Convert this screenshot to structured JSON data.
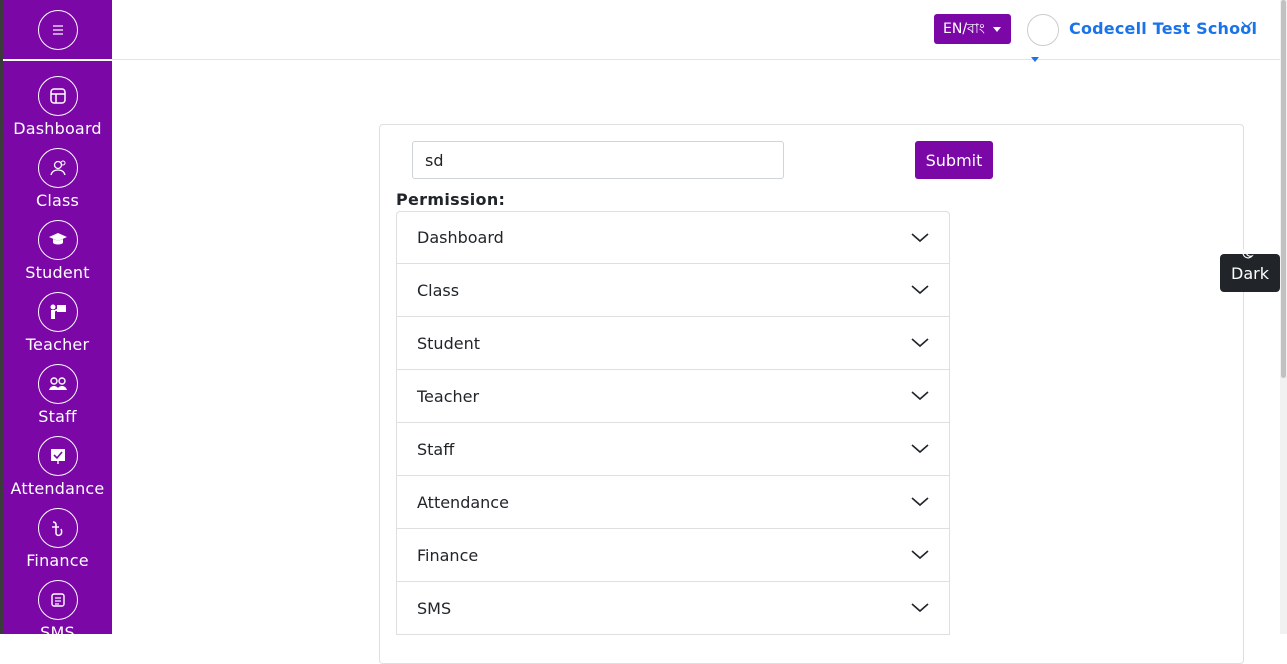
{
  "header": {
    "language_button": "EN/বাং",
    "school_name": "Codecell Test School"
  },
  "sidebar": {
    "items": [
      {
        "label": "Dashboard",
        "icon": "dashboard-icon"
      },
      {
        "label": "Class",
        "icon": "class-icon"
      },
      {
        "label": "Student",
        "icon": "graduation-cap-icon"
      },
      {
        "label": "Teacher",
        "icon": "teacher-icon"
      },
      {
        "label": "Staff",
        "icon": "staff-icon"
      },
      {
        "label": "Attendance",
        "icon": "attendance-icon"
      },
      {
        "label": "Finance",
        "icon": "taka-icon"
      },
      {
        "label": "SMS",
        "icon": "sms-icon"
      }
    ]
  },
  "form": {
    "name_value": "sd",
    "submit_label": "Submit",
    "permission_label": "Permission:"
  },
  "permissions": [
    "Dashboard",
    "Class",
    "Student",
    "Teacher",
    "Staff",
    "Attendance",
    "Finance",
    "SMS"
  ],
  "theme_toggle": {
    "label": "Dark"
  },
  "colors": {
    "accent": "#7a07a6",
    "link": "#1a73e8"
  }
}
